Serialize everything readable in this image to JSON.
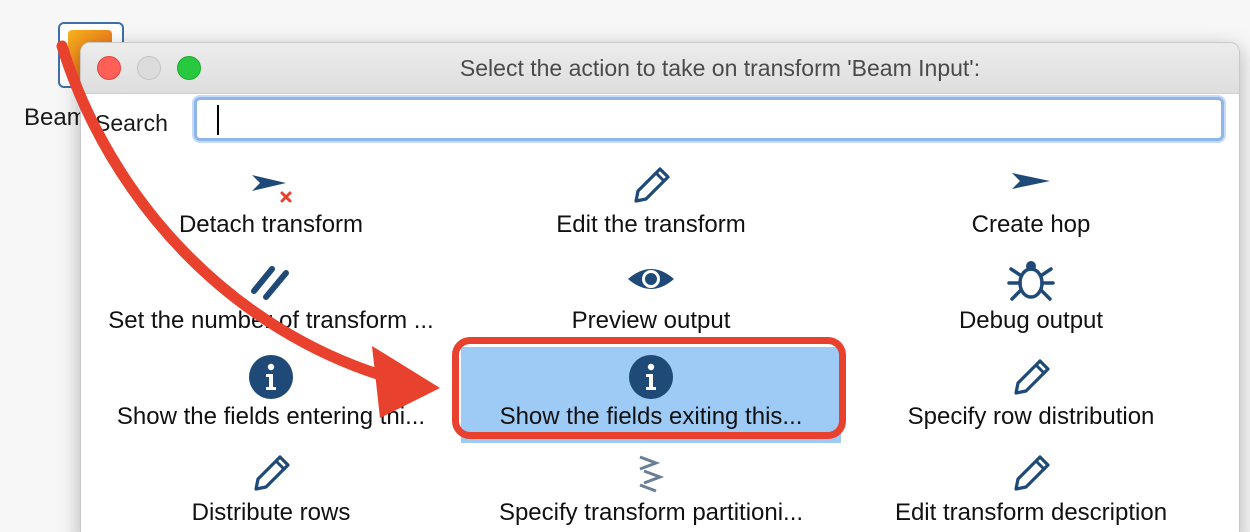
{
  "background": {
    "transform_label": "Beam Input"
  },
  "dialog": {
    "title": "Select the action to take on transform 'Beam Input':",
    "search": {
      "label": "Search",
      "value": ""
    },
    "actions": [
      {
        "label": "Detach transform",
        "icon": "detach-hop-icon"
      },
      {
        "label": "Edit the transform",
        "icon": "pencil-icon"
      },
      {
        "label": "Create hop",
        "icon": "hop-arrow-icon"
      },
      {
        "label": "Set the number of transform ...",
        "icon": "parallel-lines-icon"
      },
      {
        "label": "Preview output",
        "icon": "eye-icon"
      },
      {
        "label": "Debug output",
        "icon": "bug-icon"
      },
      {
        "label": "Show the fields entering thi...",
        "icon": "info-icon"
      },
      {
        "label": "Show the fields exiting this...",
        "icon": "info-icon",
        "selected": true
      },
      {
        "label": "Specify row distribution",
        "icon": "pencil-icon"
      },
      {
        "label": "Distribute rows",
        "icon": "pencil-icon"
      },
      {
        "label": "Specify transform partitioni...",
        "icon": "partition-arrows-icon"
      },
      {
        "label": "Edit transform description",
        "icon": "pencil-icon"
      }
    ]
  },
  "colors": {
    "selected_bg": "#9ecbf6",
    "icon_blue": "#1f4a78",
    "annotation_red": "#e8412d"
  }
}
